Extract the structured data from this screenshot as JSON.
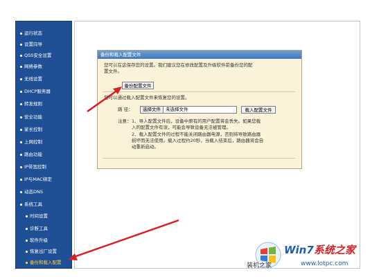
{
  "sidebar": {
    "items": [
      {
        "label": "运行状态"
      },
      {
        "label": "设置向导"
      },
      {
        "label": "QSS安全设置"
      },
      {
        "label": "网络参数"
      },
      {
        "label": "无线设置"
      },
      {
        "label": "DHCP服务器"
      },
      {
        "label": "转发规则"
      },
      {
        "label": "安全功能"
      },
      {
        "label": "家长控制"
      },
      {
        "label": "上网控制"
      },
      {
        "label": "路由功能"
      },
      {
        "label": "IP带宽控制"
      },
      {
        "label": "IP与MAC绑定"
      },
      {
        "label": "动态DNS"
      },
      {
        "label": "系统工具"
      }
    ],
    "subitems": [
      {
        "label": "时间设置"
      },
      {
        "label": "诊断工具"
      },
      {
        "label": "软件升级"
      },
      {
        "label": "恢复出厂设置"
      },
      {
        "label": "备份和载入配置"
      }
    ]
  },
  "panel": {
    "title": "备份和载入配置文件",
    "intro_line1": "您可以在这保存您的设置。我们建议您在修改配置及升级软件前备份您的配",
    "intro_line2": "置文件。",
    "backup_button": "备份配置文件",
    "load_intro": "您可以通过载入配置文件来恢复您的设置。",
    "path_label": "路  径：",
    "choose_file": "选择文件",
    "no_file": "未选择文件",
    "load_button": "载入配置文件",
    "note_label": "注意：",
    "note_1_line1": "1、导入配置文件后，设备中原有的用户配置将会丢失。如果您载",
    "note_1_line2": "入的配置文件有误，可能会导致设备无法被管理。",
    "note_2_line1": "2、载入配置文件的过程不能关闭路由器电源，否则将导致路由器",
    "note_2_line2": "损坏而无法使用。载入过程约20秒，当载入结束后，路由器将会自",
    "note_2_line3": "动重新启动。"
  },
  "watermark": {
    "brand_w7": "Win7",
    "brand_cn": "系统之家",
    "sub": "装机之家",
    "site": "www.lotpc.com"
  },
  "colors": {
    "sidebar_bg": "#1f4f94",
    "panel_bg": "#fbf3d9",
    "arrow": "#d81f26"
  }
}
